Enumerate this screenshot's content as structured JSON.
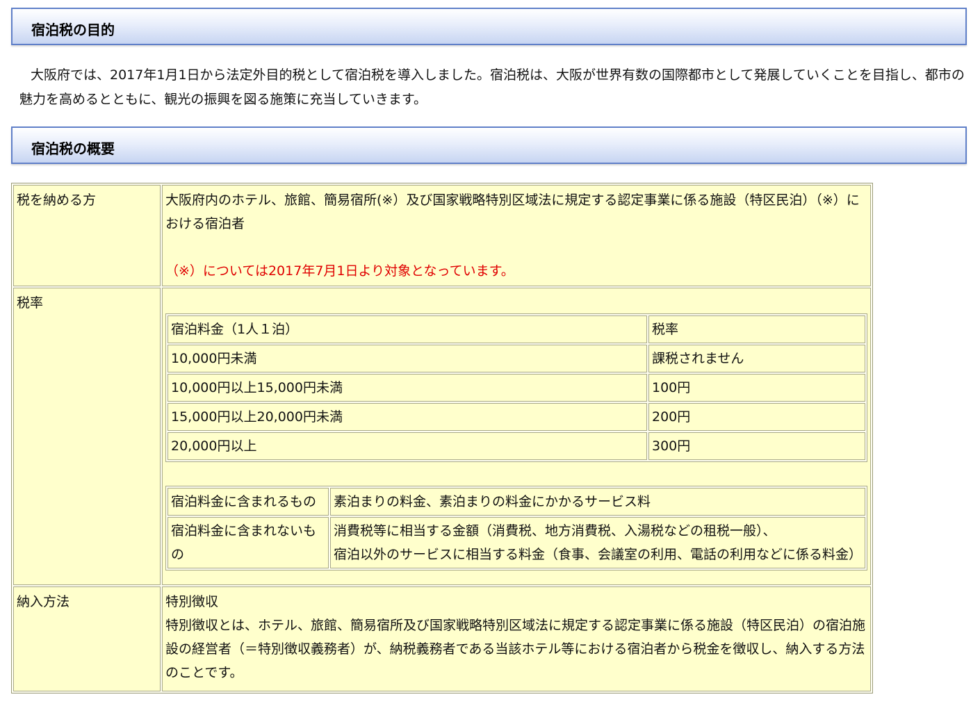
{
  "section1": {
    "title": "宿泊税の目的",
    "paragraph": "大阪府では、2017年1月1日から法定外目的税として宿泊税を導入しました。宿泊税は、大阪が世界有数の国際都市として発展していくことを目指し、都市の魅力を高めるとともに、観光の振興を図る施策に充当していきます。"
  },
  "section2": {
    "title": "宿泊税の概要"
  },
  "overview": {
    "taxpayer": {
      "label": "税を納める方",
      "text": "大阪府内のホテル、旅館、簡易宿所(※）及び国家戦略特別区域法に規定する認定事業に係る施設（特区民泊）（※）における宿泊者",
      "note": "（※）については2017年7月1日より対象となっています。"
    },
    "rate": {
      "label": "税率",
      "header": {
        "col1": "宿泊料金（1人１泊）",
        "col2": "税率"
      },
      "rows": [
        {
          "range": "10,000円未満",
          "tax": "課税されません"
        },
        {
          "range": "10,000円以上15,000円未満",
          "tax": "100円"
        },
        {
          "range": "15,000円以上20,000円未満",
          "tax": "200円"
        },
        {
          "range": "20,000円以上",
          "tax": "300円"
        }
      ],
      "included_label": "宿泊料金に含まれるもの",
      "included_value": "素泊まりの料金、素泊まりの料金にかかるサービス料",
      "excluded_label": "宿泊料金に含まれないもの",
      "excluded_line1": "消費税等に相当する金額（消費税、地方消費税、入湯税などの租税一般）、",
      "excluded_line2": "宿泊以外のサービスに相当する料金（食事、会議室の利用、電話の利用などに係る料金）"
    },
    "payment": {
      "label": "納入方法",
      "title": "特別徴収",
      "text": "特別徴収とは、ホテル、旅館、簡易宿所及び国家戦略特別区域法に規定する認定事業に係る施設（特区民泊）の宿泊施設の経営者（＝特別徴収義務者）が、納税義務者である当該ホテル等における宿泊者から税金を徴収し、納入する方法のことです。"
    }
  }
}
